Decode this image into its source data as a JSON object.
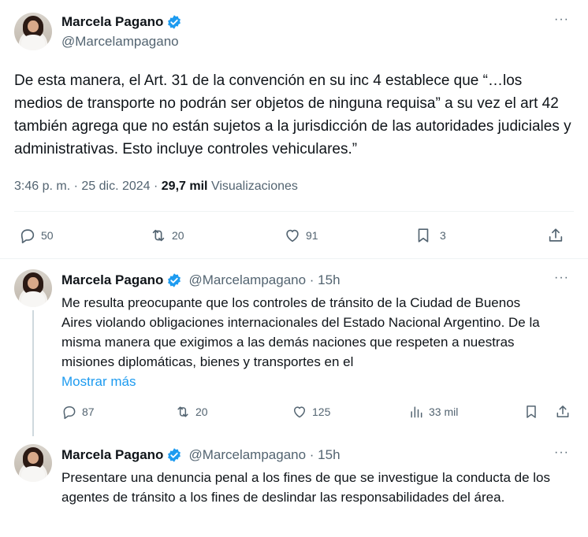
{
  "main_tweet": {
    "author_name": "Marcela Pagano",
    "handle": "@Marcelampagano",
    "more": "···",
    "text": "De esta manera, el Art. 31 de la convención en su inc 4 establece que “…los medios de transporte no podrán ser objetos de ninguna requisa” a su vez el art 42 también agrega que no están sujetos a la jurisdicción de las autoridades judiciales y administrativas. Esto incluye controles vehiculares.”",
    "time": "3:46 p. m. · 25 dic. 2024 ·",
    "views_count": "29,7 mil",
    "views_label": "Visualizaciones",
    "replies": "50",
    "reposts": "20",
    "likes": "91",
    "bookmarks": "3"
  },
  "reply_1": {
    "author_name": "Marcela Pagano",
    "handle": "@Marcelampagano · 15h",
    "more": "···",
    "text": "Me resulta preocupante que los controles de tránsito de la Ciudad de Buenos Aires violando obligaciones internacionales del Estado Nacional Argentino. De la misma manera que exigimos a las demás naciones que respeten a nuestras misiones diplomáticas, bienes y transportes en el",
    "show_more": "Mostrar más",
    "replies": "87",
    "reposts": "20",
    "likes": "125",
    "views": "33 mil"
  },
  "reply_2": {
    "author_name": "Marcela Pagano",
    "handle": "@Marcelampagano · 15h",
    "more": "···",
    "text": "Presentare una denuncia penal a los fines de que se investigue la conducta de los agentes de tránsito a los fines de deslindar las responsabilidades del área."
  },
  "colors": {
    "accent": "#1d9bf0",
    "text": "#0f1419",
    "secondary": "#536471"
  }
}
